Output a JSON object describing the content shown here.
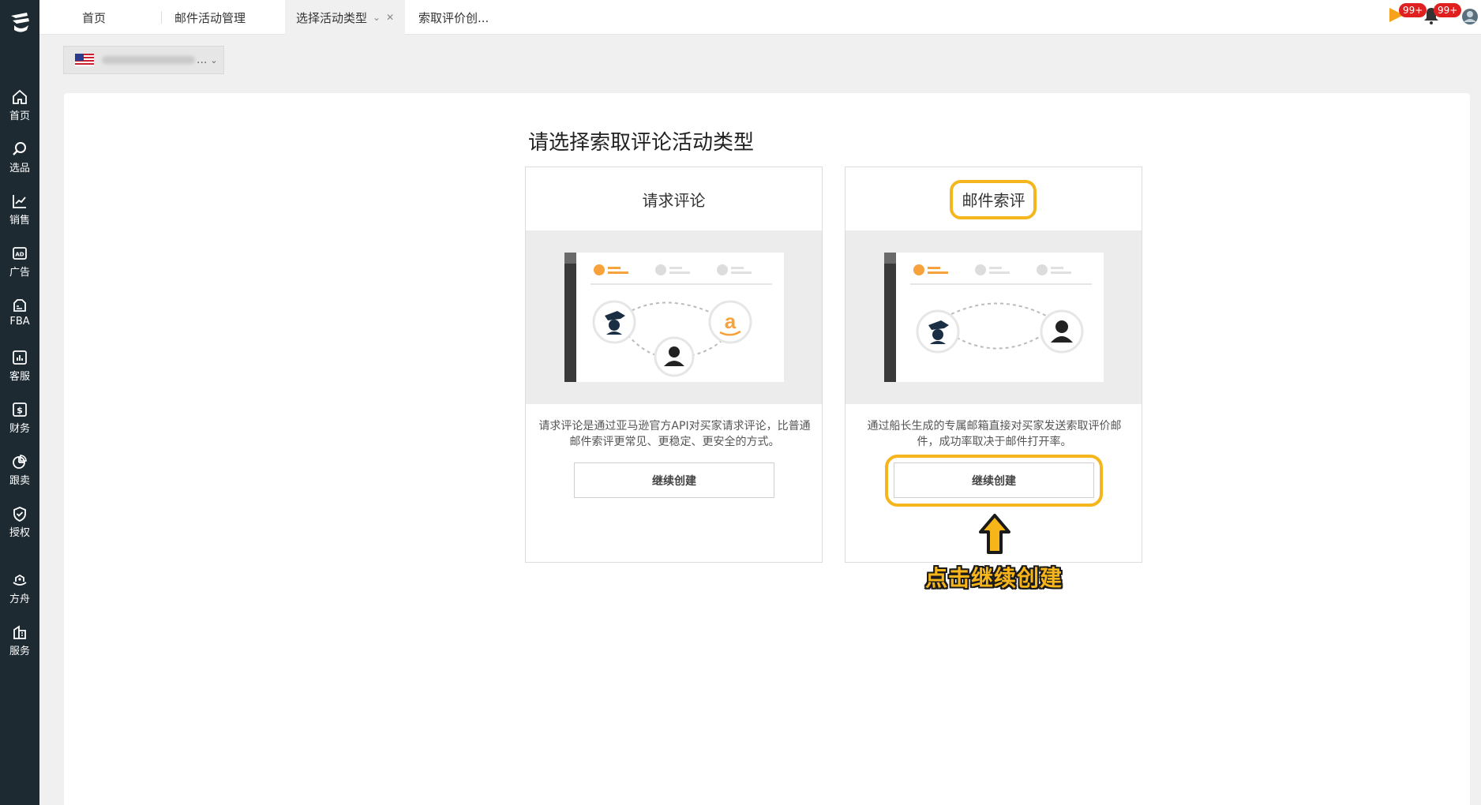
{
  "sidebar": {
    "items": [
      {
        "label": "首页",
        "icon": "home-icon"
      },
      {
        "label": "选品",
        "icon": "search-icon"
      },
      {
        "label": "销售",
        "icon": "chart-line-icon"
      },
      {
        "label": "广告",
        "icon": "ad-icon"
      },
      {
        "label": "FBA",
        "icon": "box-icon"
      },
      {
        "label": "客服",
        "icon": "bar-chart-icon"
      },
      {
        "label": "财务",
        "icon": "dollar-icon"
      },
      {
        "label": "跟卖",
        "icon": "pie-chart-icon"
      },
      {
        "label": "授权",
        "icon": "shield-check-icon"
      },
      {
        "label": "方舟",
        "icon": "ark-icon"
      },
      {
        "label": "服务",
        "icon": "building-icon"
      }
    ]
  },
  "tabs": [
    {
      "label": "首页"
    },
    {
      "label": "邮件活动管理"
    },
    {
      "label": "选择活动类型",
      "active": true
    },
    {
      "label": "索取评价创..."
    }
  ],
  "header": {
    "badge_flag": "99+",
    "badge_bell": "99+"
  },
  "store_selector": {
    "ellipsis": "...",
    "country": "US"
  },
  "main": {
    "title": "请选择索取评论活动类型",
    "cards": [
      {
        "title": "请求评论",
        "desc": "请求评论是通过亚马逊官方API对买家请求评论，比普通邮件索评更常见、更稳定、更安全的方式。",
        "button": "继续创建"
      },
      {
        "title": "邮件索评",
        "desc": "通过船长生成的专属邮箱直接对买家发送索取评价邮件，成功率取决于邮件打开率。",
        "button": "继续创建"
      }
    ]
  },
  "annotation": {
    "text": "点击继续创建"
  },
  "colors": {
    "sidebar": "#1e2a32",
    "accent": "#f5b51c",
    "orange": "#f7a23b",
    "badge": "#e02020"
  }
}
